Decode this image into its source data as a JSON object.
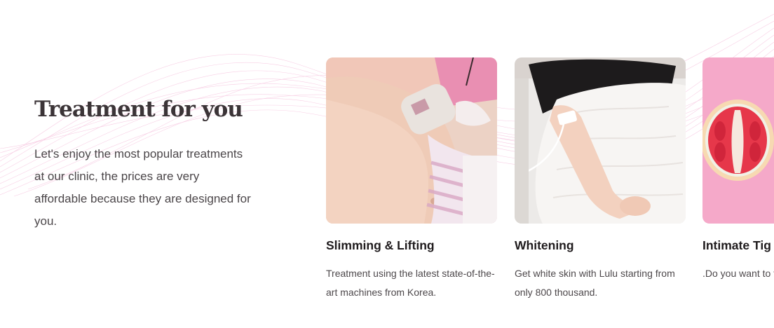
{
  "section": {
    "title": "Treatment for you",
    "description": "Let's enjoy the most popular treatments at our clinic, the prices are very affordable because they are designed for you."
  },
  "cards": [
    {
      "title": "Slimming & Lifting",
      "description": "Treatment using the latest state-of-the-art machines from Korea."
    },
    {
      "title": "Whitening",
      "description": "Get white skin with Lulu starting from only 800 thousand."
    },
    {
      "title": "Intimate Tig",
      "description": ".Do you want to feel more co"
    }
  ],
  "colors": {
    "heading": "#3b3437",
    "body_text": "#4b4649",
    "wave_accent": "#f2a8cf",
    "card_pink_background": "#f5a9c9"
  }
}
